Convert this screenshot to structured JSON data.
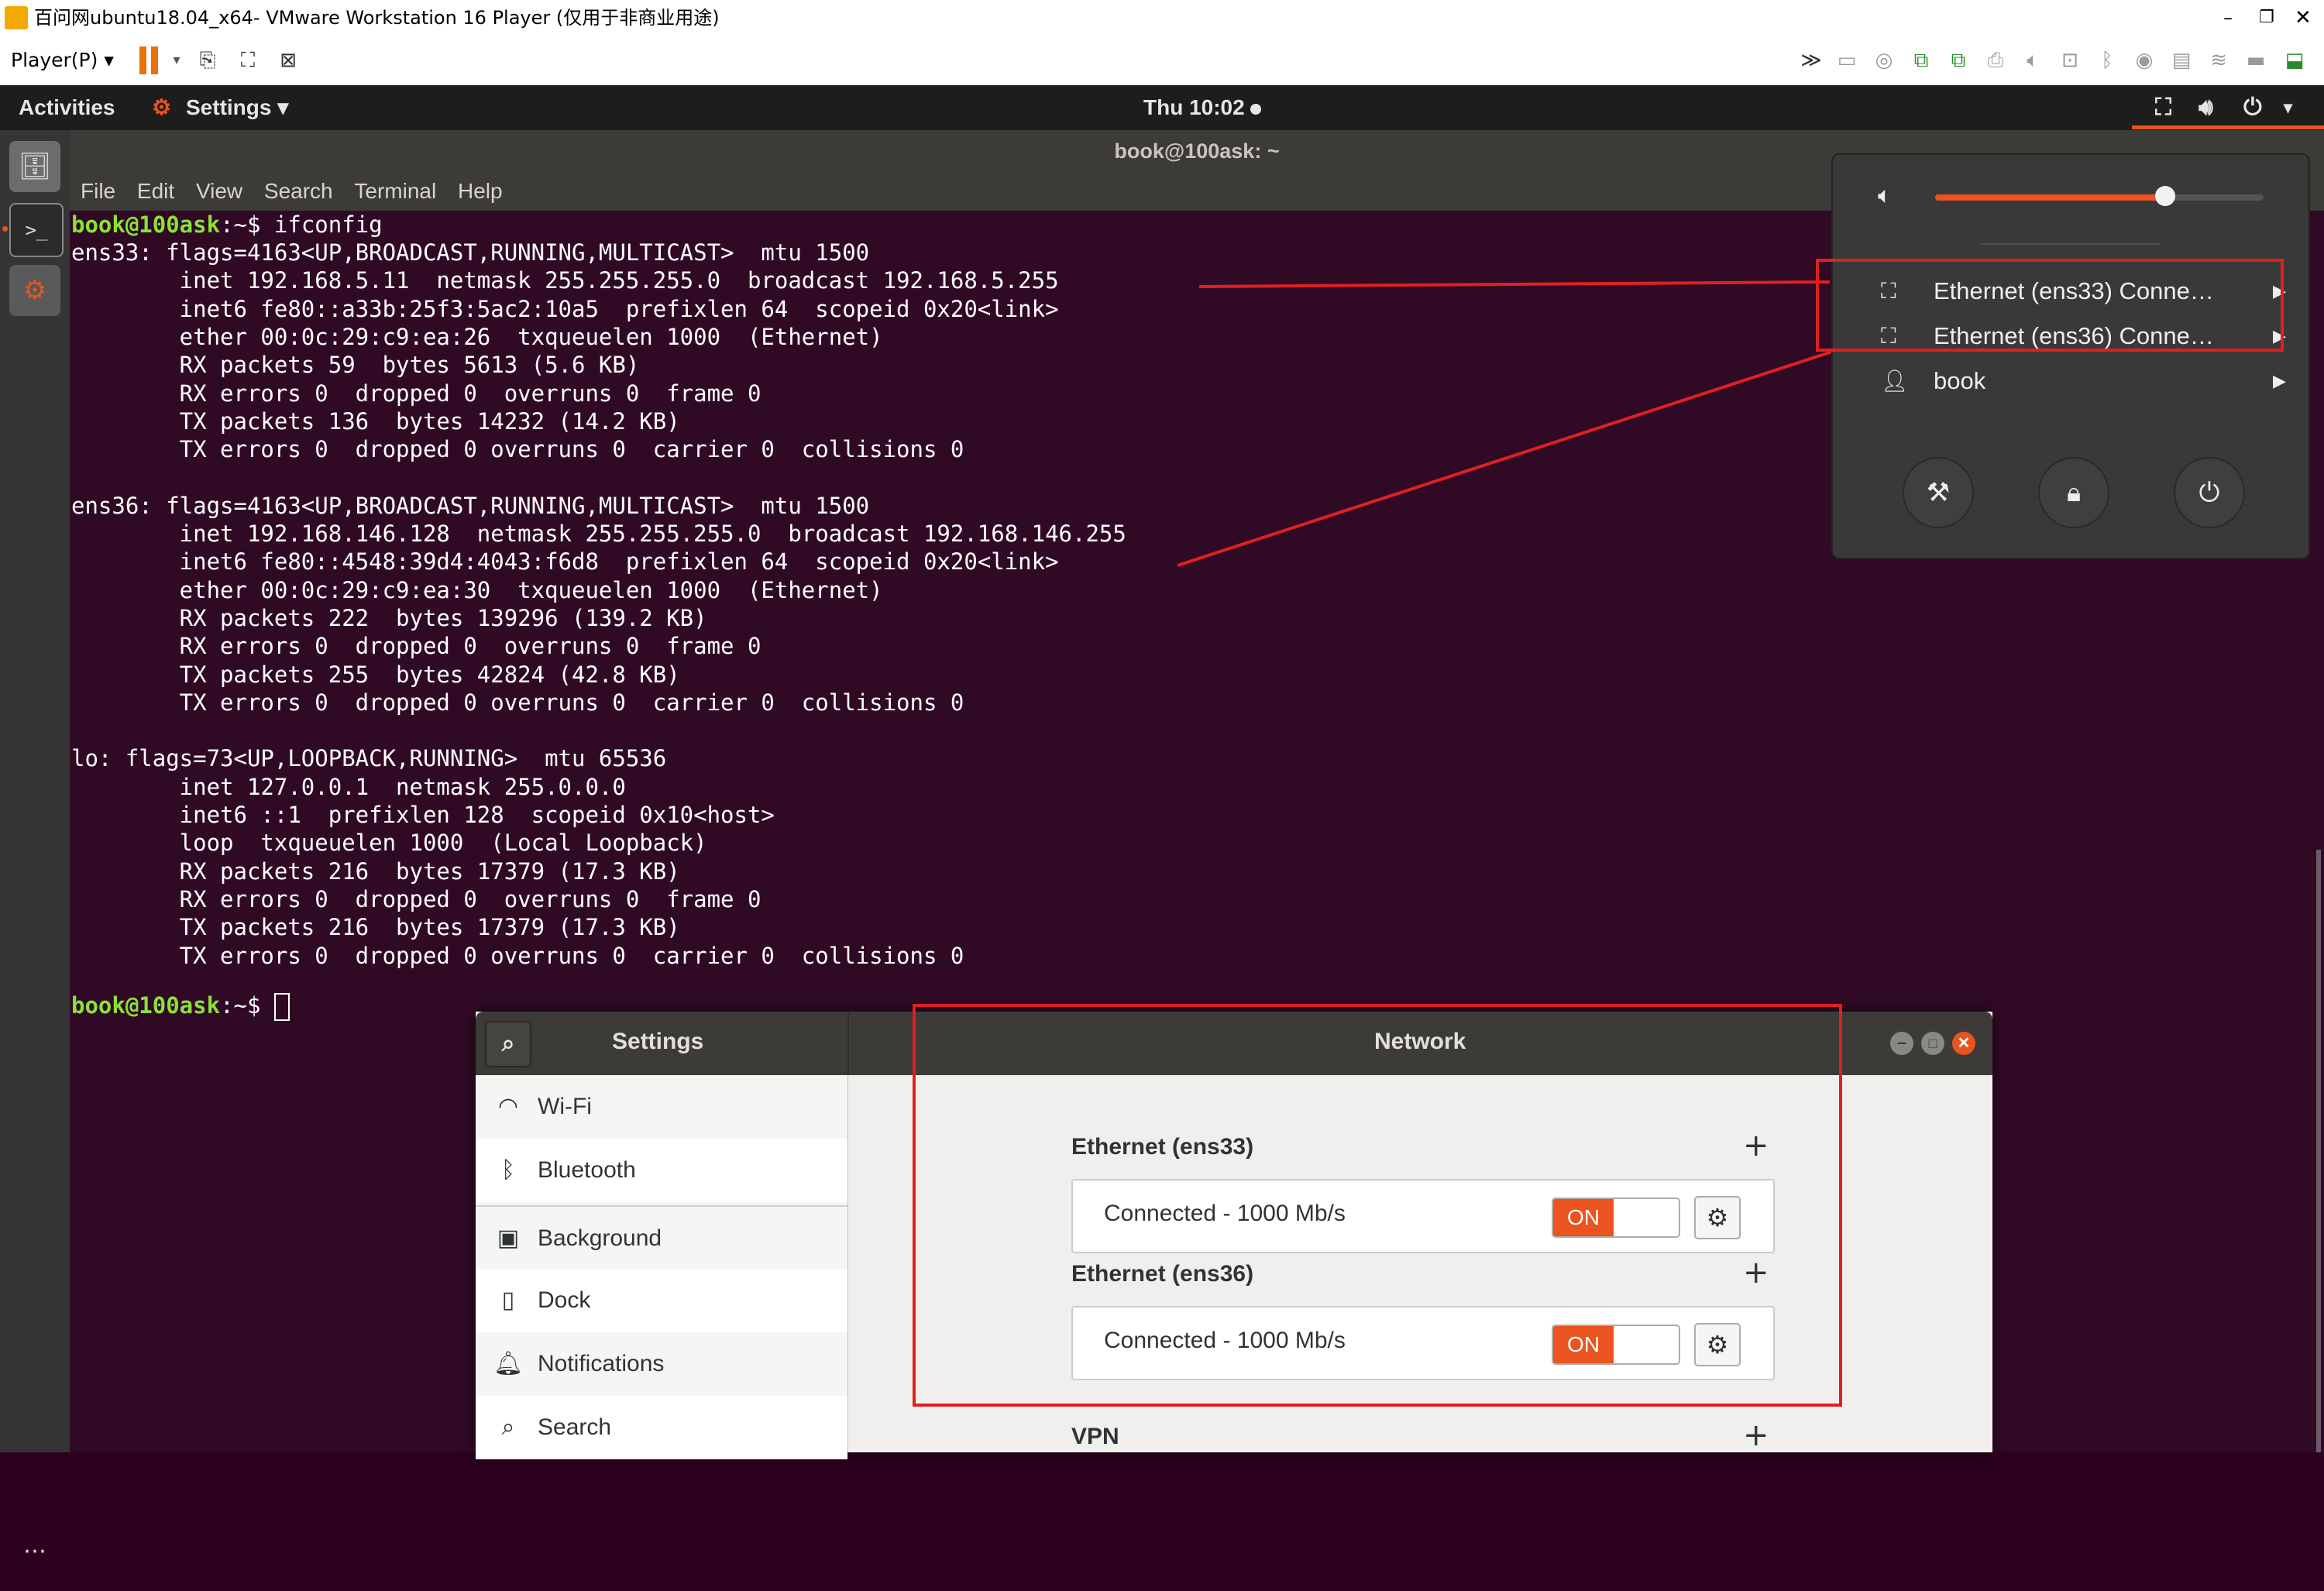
{
  "vm_window": {
    "title": "百问网ubuntu18.04_x64- VMware Workstation 16 Player (仅用于非商业用途)",
    "player_menu": "Player(P)"
  },
  "topbar": {
    "activities": "Activities",
    "app_menu": "Settings",
    "clock": "Thu 10:02"
  },
  "terminal": {
    "title": "book@100ask: ~",
    "menu": [
      "File",
      "Edit",
      "View",
      "Search",
      "Terminal",
      "Help"
    ],
    "prompt": "book@100ask",
    "prompt_suffix": ":~$ ",
    "command": "ifconfig",
    "output": [
      "ens33: flags=4163<UP,BROADCAST,RUNNING,MULTICAST>  mtu 1500",
      "        inet 192.168.5.11  netmask 255.255.255.0  broadcast 192.168.5.255",
      "        inet6 fe80::a33b:25f3:5ac2:10a5  prefixlen 64  scopeid 0x20<link>",
      "        ether 00:0c:29:c9:ea:26  txqueuelen 1000  (Ethernet)",
      "        RX packets 59  bytes 5613 (5.6 KB)",
      "        RX errors 0  dropped 0  overruns 0  frame 0",
      "        TX packets 136  bytes 14232 (14.2 KB)",
      "        TX errors 0  dropped 0 overruns 0  carrier 0  collisions 0",
      "",
      "ens36: flags=4163<UP,BROADCAST,RUNNING,MULTICAST>  mtu 1500",
      "        inet 192.168.146.128  netmask 255.255.255.0  broadcast 192.168.146.255",
      "        inet6 fe80::4548:39d4:4043:f6d8  prefixlen 64  scopeid 0x20<link>",
      "        ether 00:0c:29:c9:ea:30  txqueuelen 1000  (Ethernet)",
      "        RX packets 222  bytes 139296 (139.2 KB)",
      "        RX errors 0  dropped 0  overruns 0  frame 0",
      "        TX packets 255  bytes 42824 (42.8 KB)",
      "        TX errors 0  dropped 0 overruns 0  carrier 0  collisions 0",
      "",
      "lo: flags=73<UP,LOOPBACK,RUNNING>  mtu 65536",
      "        inet 127.0.0.1  netmask 255.0.0.0",
      "        inet6 ::1  prefixlen 128  scopeid 0x10<host>",
      "        loop  txqueuelen 1000  (Local Loopback)",
      "        RX packets 216  bytes 17379 (17.3 KB)",
      "        RX errors 0  dropped 0  overruns 0  frame 0",
      "        TX packets 216  bytes 17379 (17.3 KB)",
      "        TX errors 0  dropped 0 overruns 0  carrier 0  collisions 0"
    ]
  },
  "system_menu": {
    "volume_level": 0.7,
    "items": [
      {
        "label": "Ethernet (ens33) Conne…"
      },
      {
        "label": "Ethernet (ens36) Conne…"
      },
      {
        "label": "book"
      }
    ]
  },
  "settings": {
    "sidebar_title": "Settings",
    "panel_title": "Network",
    "sidebar": [
      {
        "label": "Wi-Fi",
        "icon": "wifi-icon"
      },
      {
        "label": "Bluetooth",
        "icon": "bluetooth-icon"
      },
      {
        "label": "Background",
        "icon": "background-icon"
      },
      {
        "label": "Dock",
        "icon": "dock-icon"
      },
      {
        "label": "Notifications",
        "icon": "bell-icon"
      },
      {
        "label": "Search",
        "icon": "search-icon"
      }
    ],
    "sections": [
      {
        "title": "Ethernet (ens33)",
        "status": "Connected - 1000 Mb/s",
        "switch": "ON"
      },
      {
        "title": "Ethernet (ens36)",
        "status": "Connected - 1000 Mb/s",
        "switch": "ON"
      }
    ],
    "vpn_title": "VPN"
  },
  "colors": {
    "accent": "#e95420",
    "terminal_bg": "#300a24",
    "prompt": "#8ae234",
    "annotation": "#e02020"
  }
}
